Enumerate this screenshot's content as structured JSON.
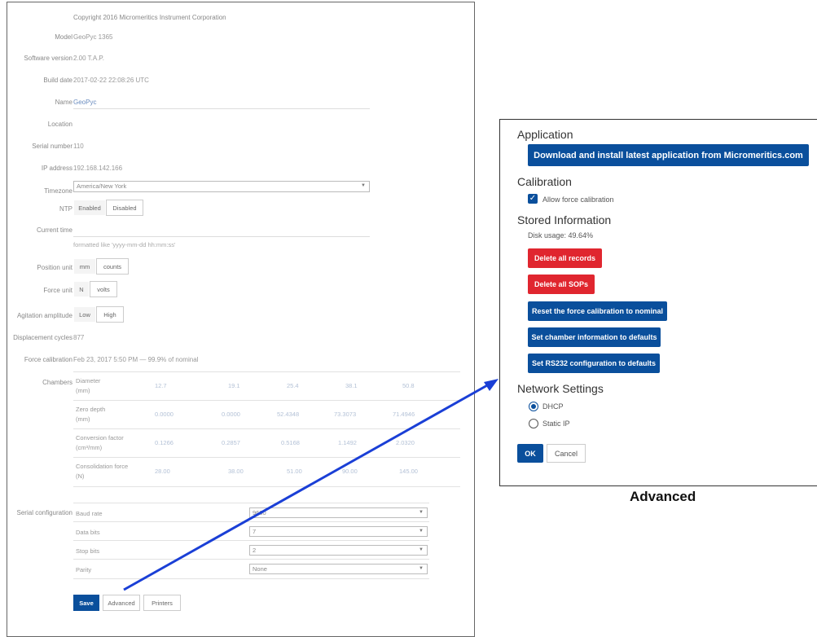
{
  "left": {
    "copyright": "Copyright 2016 Micromeritics Instrument Corporation",
    "fields": {
      "model_label": "Model",
      "model_value": "GeoPyc 1365",
      "software_label": "Software version",
      "software_value": "2.00 T.A.P.",
      "build_label": "Build date",
      "build_value": "2017-02-22 22:08:26 UTC",
      "name_label": "Name",
      "name_value": "GeoPyc",
      "location_label": "Location",
      "serial_label": "Serial number",
      "serial_value": "110",
      "ip_label": "IP address",
      "ip_value": "192.168.142.166",
      "timezone_label": "Timezone",
      "timezone_value": "America/New York",
      "ntp_label": "NTP",
      "ntp_enabled": "Enabled",
      "ntp_disabled": "Disabled",
      "current_time_label": "Current time",
      "current_time_hint": "formatted like 'yyyy-mm-dd hh:mm:ss'",
      "position_label": "Position unit",
      "position_mm": "mm",
      "position_counts": "counts",
      "force_label": "Force unit",
      "force_n": "N",
      "force_volts": "volts",
      "agitation_label": "Agitation amplitude",
      "agitation_low": "Low",
      "agitation_high": "High",
      "displacement_label": "Displacement cycles",
      "displacement_value": "877",
      "force_cal_label": "Force calibration",
      "force_cal_value": "Feb 23, 2017 5:50 PM — 99.9% of nominal",
      "chambers_label": "Chambers",
      "serial_config_label": "Serial configuration"
    },
    "chambers": [
      {
        "name_line1": "Diameter",
        "name_line2": "(mm)",
        "values": [
          "12.7",
          "19.1",
          "25.4",
          "38.1",
          "50.8"
        ]
      },
      {
        "name_line1": "Zero depth",
        "name_line2": "(mm)",
        "values": [
          "0.0000",
          "0.0000",
          "52.4348",
          "73.3073",
          "71.4946"
        ]
      },
      {
        "name_line1": "Conversion factor",
        "name_line2": "(cm³/mm)",
        "values": [
          "0.1266",
          "0.2857",
          "0.5168",
          "1.1492",
          "2.0320"
        ]
      },
      {
        "name_line1": "Consolidation force",
        "name_line2": "(N)",
        "values": [
          "28.00",
          "38.00",
          "51.00",
          "90.00",
          "145.00"
        ]
      }
    ],
    "serial": [
      {
        "label": "Baud rate",
        "value": "9600"
      },
      {
        "label": "Data bits",
        "value": "7"
      },
      {
        "label": "Stop bits",
        "value": "2"
      },
      {
        "label": "Parity",
        "value": "None"
      }
    ],
    "buttons": {
      "save": "Save",
      "advanced": "Advanced",
      "printers": "Printers"
    }
  },
  "advanced": {
    "caption": "Advanced",
    "application_heading": "Application",
    "download_button": "Download and install latest application from Micromeritics.com",
    "calibration_heading": "Calibration",
    "allow_force_label": "Allow force calibration",
    "allow_force_checked": true,
    "stored_heading": "Stored Information",
    "disk_usage": "Disk usage: 49.64%",
    "delete_records": "Delete all records",
    "delete_sops": "Delete all SOPs",
    "reset_force": "Reset the force calibration to nominal",
    "set_chamber": "Set chamber information to defaults",
    "set_rs232": "Set RS232 configuration to defaults",
    "network_heading": "Network Settings",
    "dhcp_label": "DHCP",
    "static_label": "Static IP",
    "selected_network": "DHCP",
    "ok": "OK",
    "cancel": "Cancel"
  },
  "colors": {
    "primary": "#0a4f9c",
    "danger": "#e0262f",
    "arrow": "#1a3fd6"
  }
}
